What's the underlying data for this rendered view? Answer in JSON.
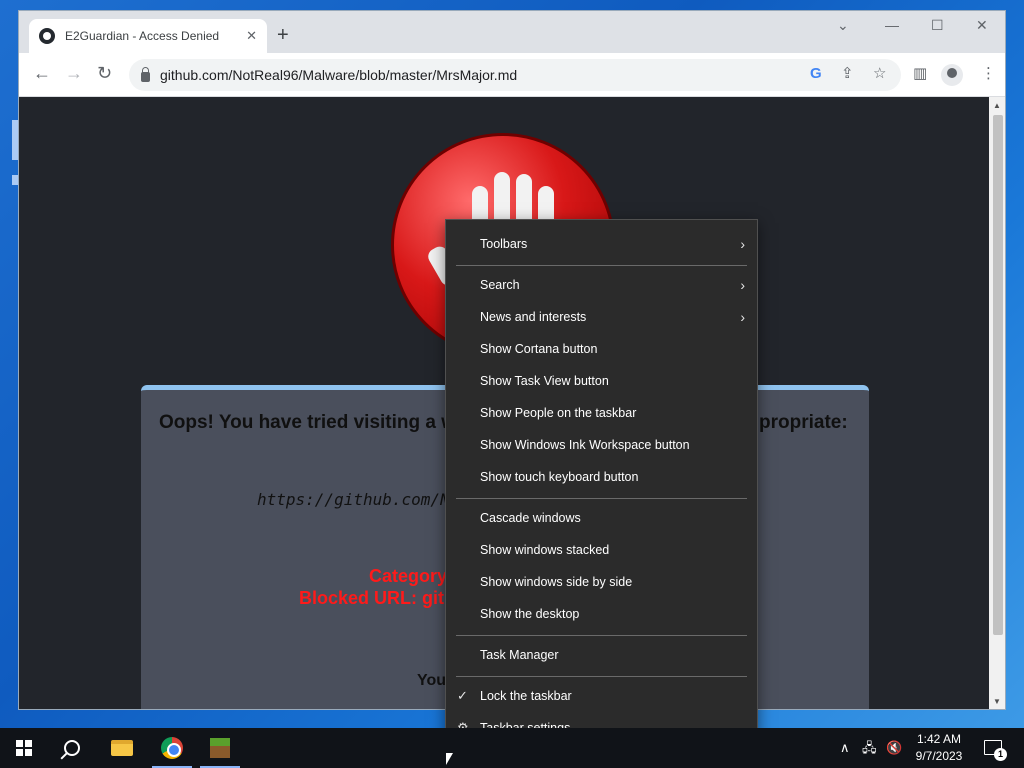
{
  "browser": {
    "tab_title": "E2Guardian - Access Denied",
    "url": "github.com/NotReal96/Malware/blob/master/MrsMajor.md"
  },
  "page": {
    "heading_left": "Oops! You have tried visiting a w",
    "heading_right": "propriate:",
    "blocked_url_partial": "https://github.com/NotRe",
    "category_partial": "Category",
    "blocked_url_label_partial": "Blocked URL: git",
    "you_partial": "You"
  },
  "context_menu": {
    "items": [
      {
        "label": "Toolbars",
        "submenu": true
      },
      {
        "label": "Search",
        "submenu": true
      },
      {
        "label": "News and interests",
        "submenu": true
      },
      {
        "label": "Show Cortana button"
      },
      {
        "label": "Show Task View button"
      },
      {
        "label": "Show People on the taskbar"
      },
      {
        "label": "Show Windows Ink Workspace button"
      },
      {
        "label": "Show touch keyboard button"
      },
      {
        "label": "Cascade windows"
      },
      {
        "label": "Show windows stacked"
      },
      {
        "label": "Show windows side by side"
      },
      {
        "label": "Show the desktop"
      },
      {
        "label": "Task Manager"
      },
      {
        "label": "Lock the taskbar",
        "checked": true
      },
      {
        "label": "Taskbar settings",
        "icon": "gear-icon"
      }
    ]
  },
  "taskbar": {
    "apps": [
      "start-icon",
      "search-icon",
      "file-explorer-icon",
      "chrome-icon",
      "minecraft-icon"
    ],
    "time": "1:42 AM",
    "date": "9/7/2023",
    "notification_count": "1"
  },
  "colors": {
    "menu_bg": "#2b2b2b",
    "page_bg": "#22252b",
    "alert_red": "#ff1a1a",
    "stop_red": "#d81818"
  }
}
